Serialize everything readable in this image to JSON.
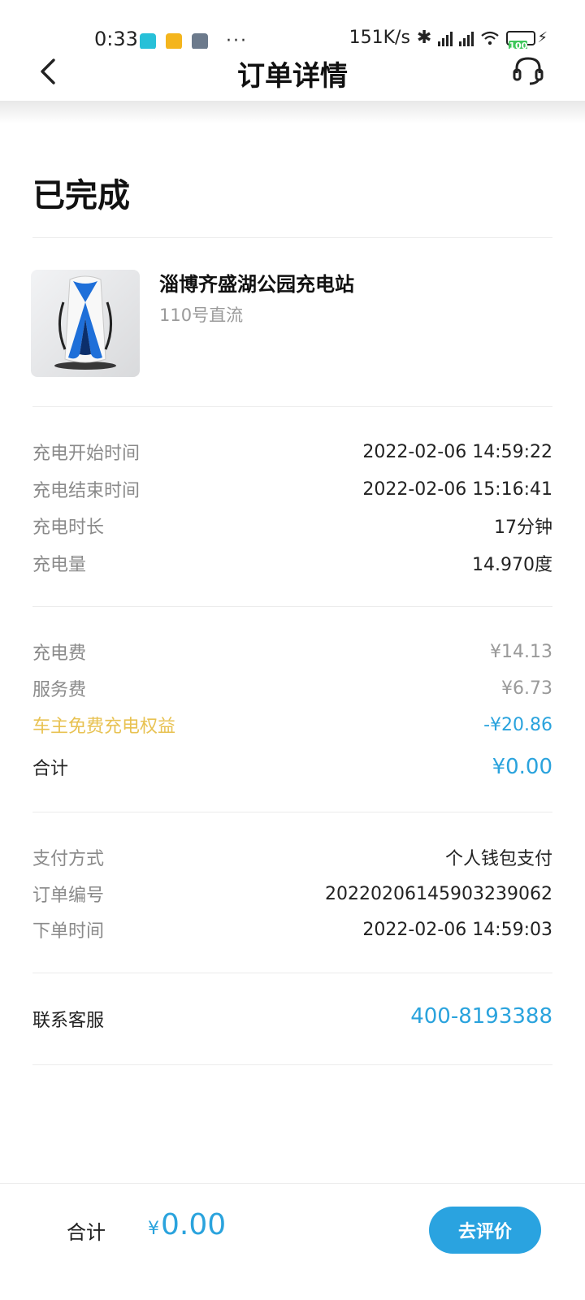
{
  "status_bar": {
    "time": "0:33",
    "dots": "···",
    "network_speed": "151K/s",
    "battery": "100"
  },
  "header": {
    "title": "订单详情",
    "back_icon": "chevron-left-icon",
    "support_icon": "headset-icon"
  },
  "order": {
    "status": "已完成"
  },
  "station": {
    "name": "淄博齐盛湖公园充电站",
    "charger": "110号直流"
  },
  "charging_info": [
    {
      "label": "充电开始时间",
      "value": "2022-02-06 14:59:22"
    },
    {
      "label": "充电结束时间",
      "value": "2022-02-06 15:16:41"
    },
    {
      "label": "充电时长",
      "value": "17分钟"
    },
    {
      "label": "充电量",
      "value": "14.970度"
    }
  ],
  "fees": {
    "charge_fee": {
      "label": "充电费",
      "value": "¥14.13"
    },
    "service_fee": {
      "label": "服务费",
      "value": "¥6.73"
    },
    "benefit": {
      "label": "车主免费充电权益",
      "value": "-¥20.86"
    },
    "total": {
      "label": "合计",
      "value": "¥0.00"
    }
  },
  "payment_info": [
    {
      "label": "支付方式",
      "value": "个人钱包支付"
    },
    {
      "label": "订单编号",
      "value": "20220206145903239062"
    },
    {
      "label": "下单时间",
      "value": "2022-02-06 14:59:03"
    }
  ],
  "contact": {
    "label": "联系客服",
    "phone": "400-8193388"
  },
  "bottom_bar": {
    "label": "合计",
    "currency": "¥",
    "amount": "0.00",
    "review_button": "去评价"
  },
  "colors": {
    "accent_blue": "#2aa3dd",
    "benefit_gold": "#e8c252",
    "label_gray": "#8a8a8a"
  }
}
